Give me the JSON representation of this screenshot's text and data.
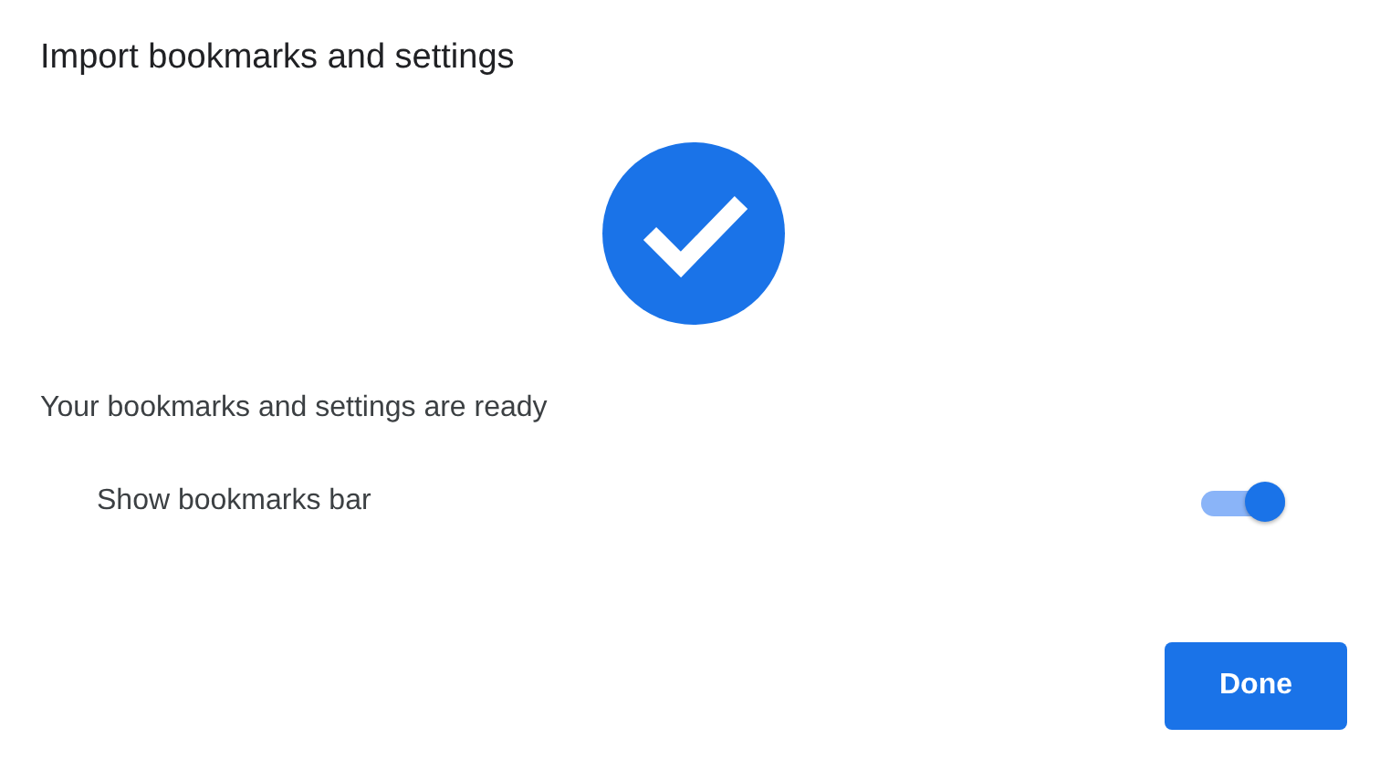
{
  "dialog": {
    "title": "Import bookmarks and settings",
    "message": "Your bookmarks and settings are ready",
    "setting": {
      "label": "Show bookmarks bar",
      "on": true
    },
    "buttons": [
      "Done"
    ]
  }
}
